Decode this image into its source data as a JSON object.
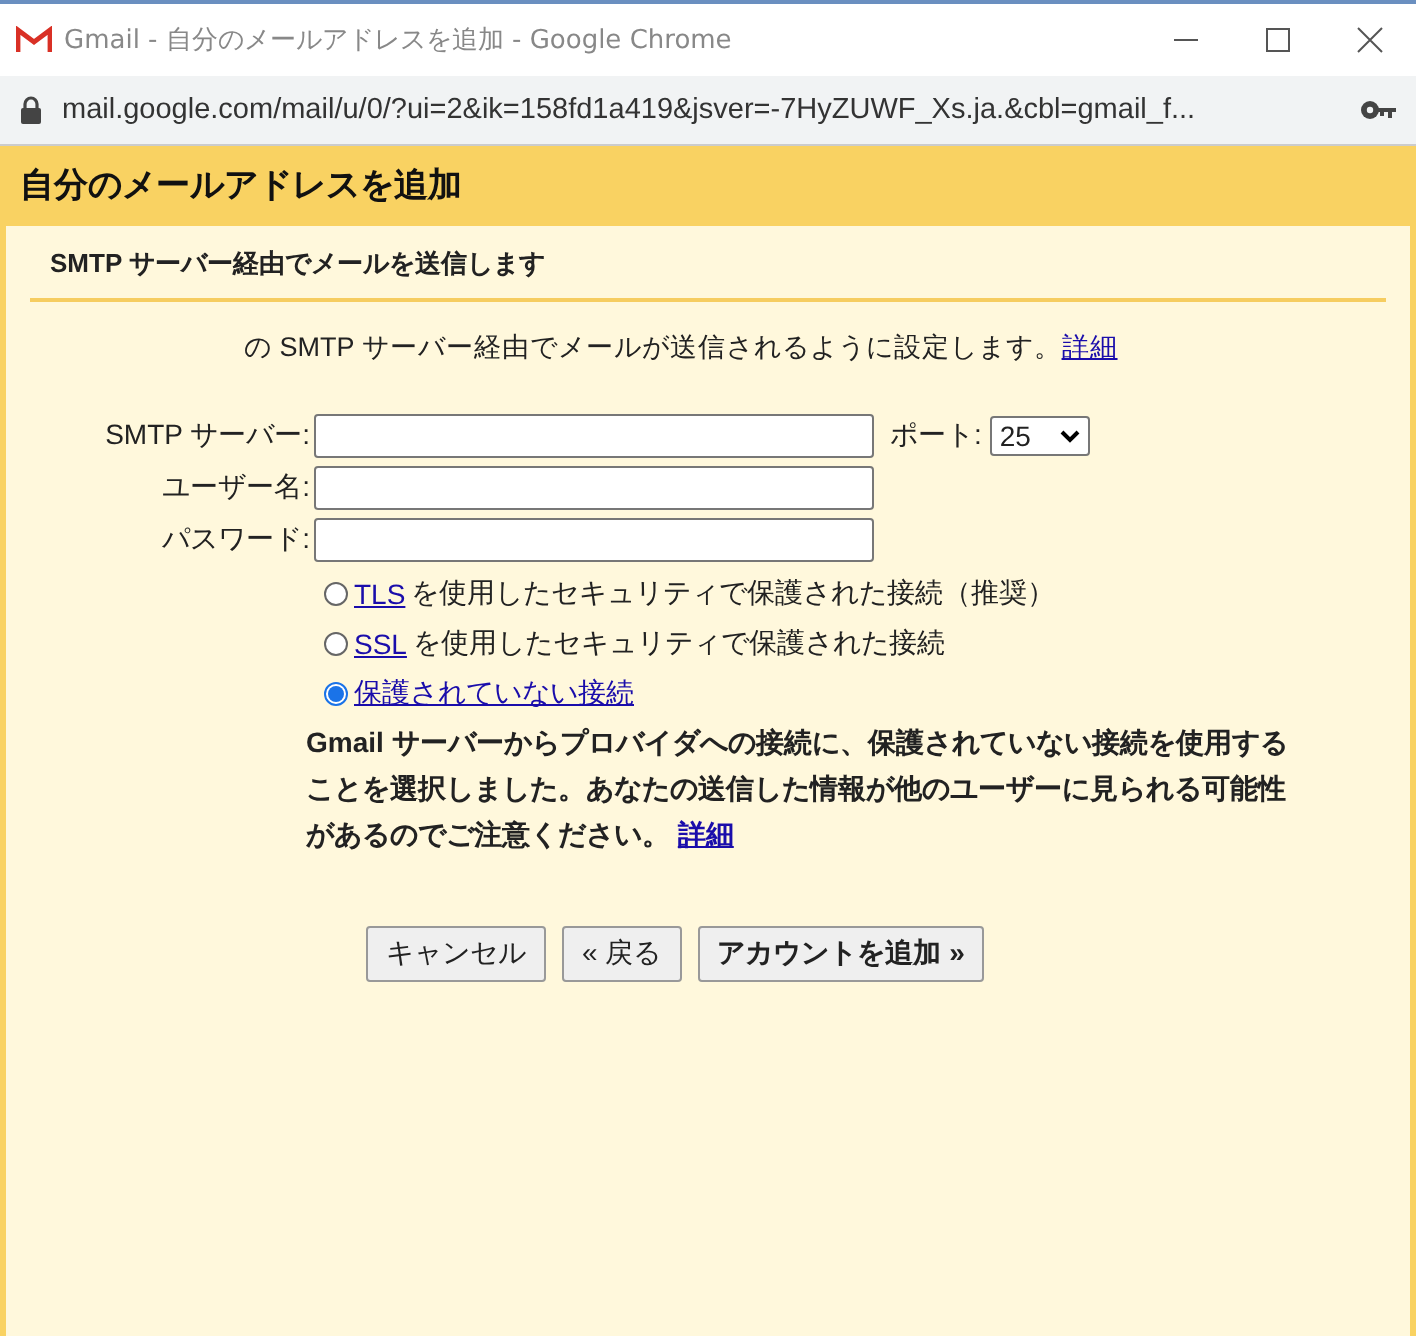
{
  "window": {
    "title": "Gmail - 自分のメールアドレスを追加 - Google Chrome",
    "url": "mail.google.com/mail/u/0/?ui=2&ik=158fd1a419&jsver=-7HyZUWF_Xs.ja.&cbl=gmail_f..."
  },
  "dialog": {
    "title": "自分のメールアドレスを追加",
    "subtitle": "SMTP サーバー経由でメールを送信します",
    "description": "の SMTP サーバー経由でメールが送信されるように設定します。",
    "description_link": "詳細",
    "fields": [
      {
        "label": "SMTP サーバー:"
      },
      {
        "label": "ユーザー名:"
      },
      {
        "label": "パスワード:"
      }
    ],
    "port": {
      "label": "ポート:",
      "value": "25"
    },
    "security_options": [
      {
        "link": "TLS",
        "text": "を使用したセキュリティで保護された接続（推奨）",
        "selected": false
      },
      {
        "link": "SSL",
        "text": "を使用したセキュリティで保護された接続",
        "selected": false
      },
      {
        "link": "保護されていない接続",
        "selected": true
      }
    ],
    "warning": "Gmail サーバーからプロバイダへの接続に、保護されていない接続を使用することを選択しました。あなたの送信した情報が他のユーザーに見られる可能性があるのでご注意ください。",
    "warning_link": "詳細",
    "buttons": [
      "キャンセル",
      "« 戻る",
      "アカウントを追加 »"
    ]
  }
}
